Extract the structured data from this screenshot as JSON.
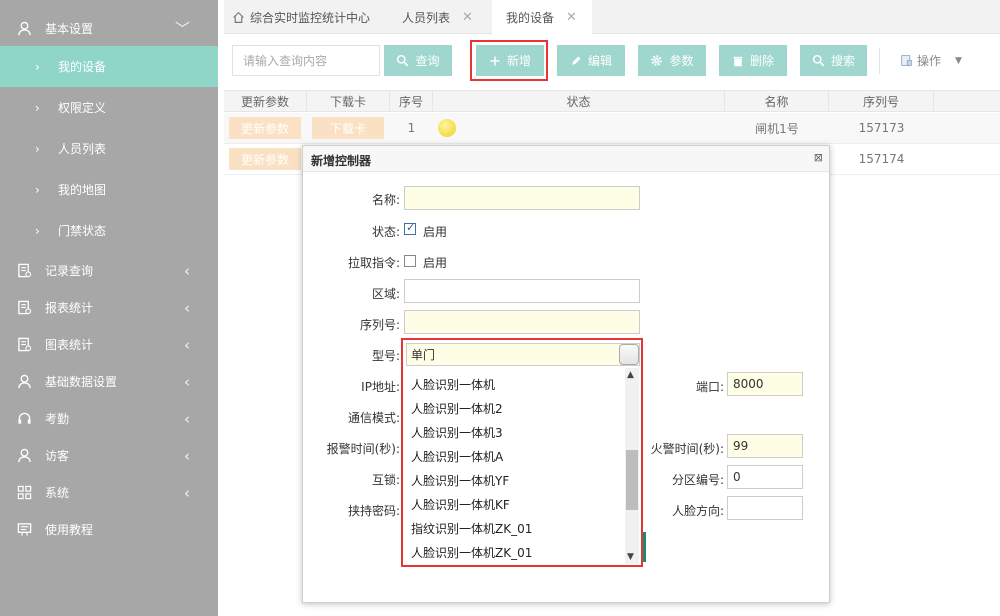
{
  "sidebar": {
    "group_basic": "基本设置",
    "sub_items": [
      "我的设备",
      "权限定义",
      "人员列表",
      "我的地图",
      "门禁状态"
    ],
    "items": [
      "记录查询",
      "报表统计",
      "图表统计",
      "基础数据设置",
      "考勤",
      "访客",
      "系统",
      "使用教程"
    ]
  },
  "tabs": [
    "综合实时监控统计中心",
    "人员列表",
    "我的设备"
  ],
  "toolbar": {
    "search_placeholder": "请输入查询内容",
    "query": "查询",
    "add": "新增",
    "edit": "编辑",
    "params": "参数",
    "delete": "删除",
    "search": "搜索",
    "ops": "操作"
  },
  "table": {
    "headers": [
      "更新参数",
      "下载卡",
      "序号",
      "状态",
      "名称",
      "序列号"
    ],
    "rows": [
      {
        "update": "更新参数",
        "download": "下载卡",
        "index": "1",
        "name": "闸机1号",
        "serial": "157173"
      },
      {
        "update": "更新参数",
        "download": "",
        "index": "",
        "name": "",
        "serial": "157174"
      }
    ]
  },
  "modal": {
    "title": "新增控制器",
    "close": "⊠",
    "labels": {
      "name": "名称:",
      "status": "状态:",
      "pull_cmd": "拉取指令:",
      "area": "区域:",
      "serial": "序列号:",
      "model": "型号:",
      "ip": "IP地址:",
      "comm_mode": "通信模式:",
      "alarm_time": "报警时间(秒):",
      "interlock": "互锁:",
      "duress_pwd": "挟持密码:",
      "port": "端口:",
      "fire_alarm": "火警时间(秒):",
      "zone_no": "分区编号:",
      "face_dir": "人脸方向:"
    },
    "enable": "启用",
    "status_checked": true,
    "pull_checked": false,
    "values": {
      "port": "8000",
      "fire_alarm": "99",
      "zone_no": "0"
    },
    "model_selected": "单门",
    "model_options": [
      "人脸识别一体机",
      "人脸识别一体机2",
      "人脸识别一体机3",
      "人脸识别一体机A",
      "人脸识别一体机YF",
      "人脸识别一体机KF",
      "指纹识别一体机ZK_01",
      "人脸识别一体机ZK_01"
    ]
  },
  "colors": {
    "sidebar_bg": "#a7a7a7",
    "accent": "#8fd5c8",
    "button": "#9fd6cd",
    "highlight": "#e53535",
    "input_yellow": "#fefde6"
  }
}
